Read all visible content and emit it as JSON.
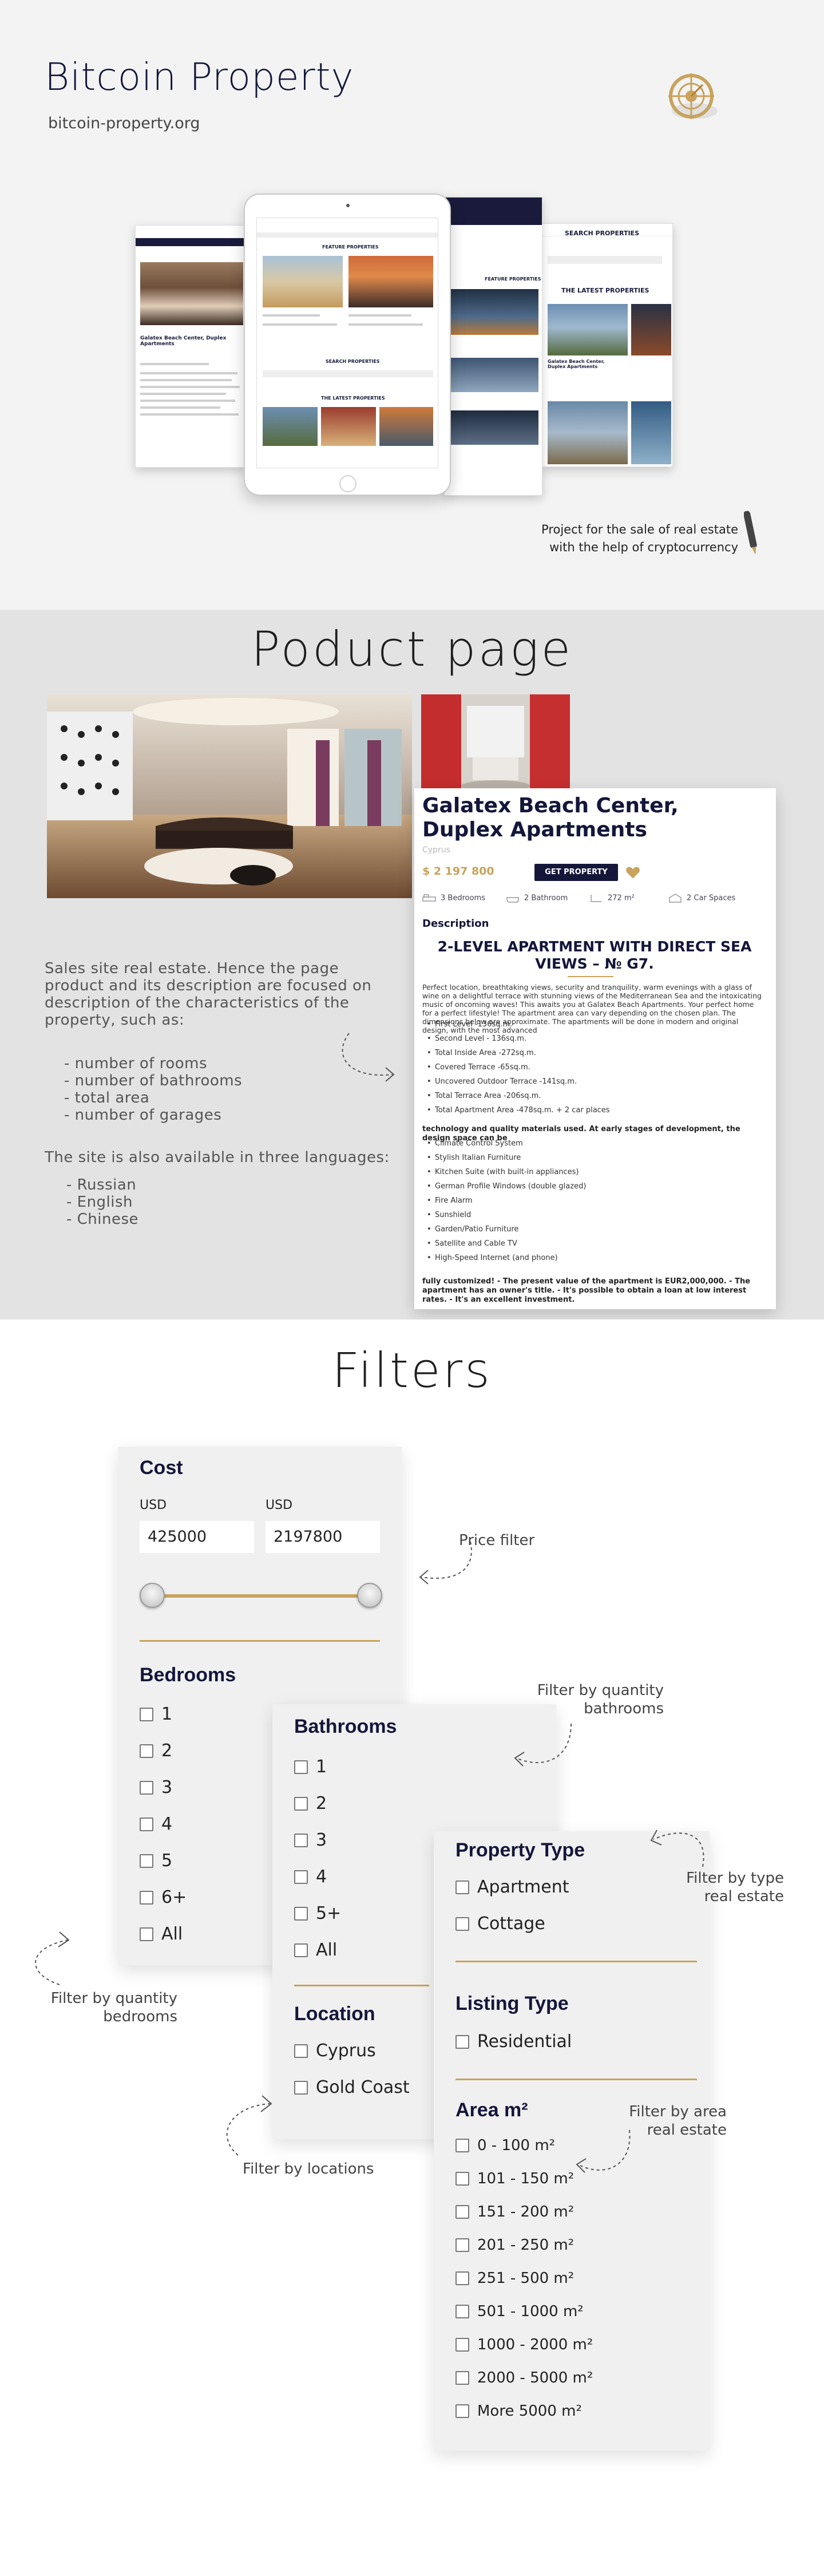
{
  "hero": {
    "title": "Bitcoin Property",
    "url": "bitcoin-property.org",
    "caption_line1": "Project for the sale of real estate",
    "caption_line2": "with the help of cryptocurrency",
    "mock_labels": {
      "feature_properties": "FEATURE PROPERTIES",
      "search_properties": "SEARCH PROPERTIES",
      "latest_properties": "THE LATEST PROPERTIES",
      "mini_title": "Galatex Beach Center, Duplex Apartments"
    }
  },
  "product_section": {
    "title": "Poduct page",
    "intro_line1": "Sales site real estate. Hence the page",
    "intro_line2": "product and its description are focused on",
    "intro_line3": "description of the characteristics of the",
    "intro_line4": "property, such as:",
    "characteristics": [
      "- number of rooms",
      "- number of bathrooms",
      "- total area",
      "- number of garages"
    ],
    "languages_intro": "The site is also available in three languages:",
    "languages": [
      "- Russian",
      "- English",
      "- Chinese"
    ],
    "card": {
      "title": "Galatex Beach Center, Duplex Apartments",
      "location": "Cyprus",
      "price": "$ 2 197 800",
      "button": "GET PROPERTY",
      "features": [
        "3 Bedrooms",
        "2 Bathroom",
        "272 m²",
        "2 Car Spaces"
      ],
      "description_heading": "Description",
      "headline": "2-LEVEL APARTMENT WITH DIRECT SEA VIEWS – № G7.",
      "paragraph": "Perfect location, breathtaking views, security and tranquility, warm evenings with a glass of wine on a delightful terrace with stunning views of the Mediterranean Sea and the intoxicating music of oncoming waves! This awaits you at Galatex Beach Apartments. Your perfect home for a perfect lifestyle! The apartment area can vary depending on the chosen plan. The dimensions below are approximate. The apartments will be done in modern and original design, with the most advanced",
      "areas": [
        "First Level -136sq.m.",
        "Second Level - 136sq.m.",
        "Total Inside Area -272sq.m.",
        "Covered Terrace -65sq.m.",
        "Uncovered Outdoor Terrace -141sq.m.",
        "Total Terrace Area -206sq.m.",
        "Total Apartment Area -478sq.m. + 2 car places"
      ],
      "tech_heading": "technology and quality materials used. At early stages of development, the design space can be",
      "amenities": [
        "Climate Control System",
        "Stylish Italian Furniture",
        "Kitchen Suite (with built-in appliances)",
        "German Profile Windows (double glazed)",
        "Fire Alarm",
        "Sunshield",
        "Garden/Patio Furniture",
        "Satellite and Cable TV",
        "High-Speed Internet (and phone)"
      ],
      "footer": "fully customized! - The present value of the apartment is EUR2,000,000. - The apartment has an owner's title. - It's possible to obtain a loan at low interest rates. - It's an excellent investment."
    }
  },
  "filters_section": {
    "title": "Filters",
    "cost": {
      "heading": "Cost",
      "currency_min": "USD",
      "currency_max": "USD",
      "min_value": "425000",
      "max_value": "2197800"
    },
    "bedrooms": {
      "heading": "Bedrooms",
      "options": [
        "1",
        "2",
        "3",
        "4",
        "5",
        "6+",
        "All"
      ]
    },
    "bathrooms": {
      "heading": "Bathrooms",
      "options": [
        "1",
        "2",
        "3",
        "4",
        "5+",
        "All"
      ]
    },
    "location": {
      "heading": "Location",
      "options": [
        "Cyprus",
        "Gold Coast"
      ]
    },
    "property_type": {
      "heading": "Property Type",
      "options": [
        "Apartment",
        "Cottage"
      ]
    },
    "listing_type": {
      "heading": "Listing Type",
      "options": [
        "Residential"
      ]
    },
    "area": {
      "heading": "Area m²",
      "options": [
        "0 - 100 m²",
        "101 - 150 m²",
        "151 - 200 m²",
        "201 - 250 m²",
        "251 - 500 m²",
        "501 - 1000 m²",
        "1000 - 2000 m²",
        "2000 - 5000 m²",
        "More 5000 m²"
      ]
    },
    "notes": {
      "price": "Price filter",
      "bathrooms_l1": "Filter by quantity",
      "bathrooms_l2": "bathrooms",
      "type_l1": "Filter by type",
      "type_l2": "real estate",
      "bedrooms_l1": "Filter by quantity",
      "bedrooms_l2": "bedrooms",
      "locations": "Filter by locations",
      "area_l1": "Filter by area",
      "area_l2": "real estate"
    }
  },
  "colors": {
    "navy": "#14163a",
    "gold": "#c8a35c",
    "panel": "#f0f0f0",
    "section_gray": "#e3e3e3"
  }
}
